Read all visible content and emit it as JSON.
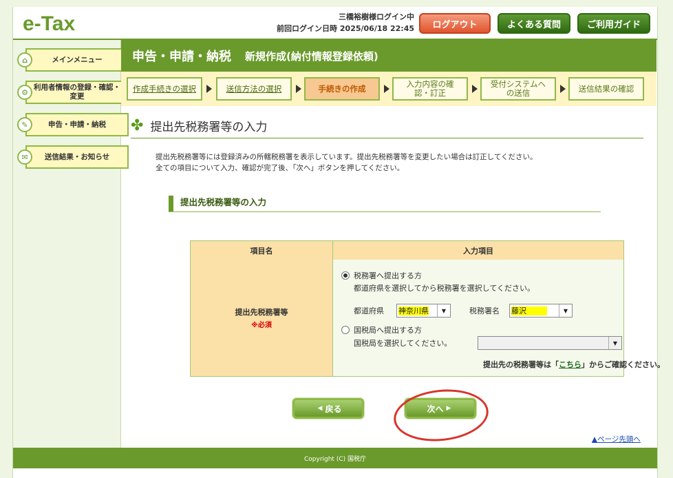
{
  "header": {
    "logo": "e-Tax",
    "user_status": "三橋裕樹様ログイン中",
    "last_login_label": "前回ログイン日時",
    "last_login_value": "2025/06/18 22:45",
    "logout_label": "ログアウト",
    "faq_label": "よくある質問",
    "guide_label": "ご利用ガイド"
  },
  "sidebar": {
    "items": [
      {
        "label": "メインメニュー",
        "icon": "home-icon"
      },
      {
        "label": "利用者情報の登録・確認・変更",
        "icon": "user-gear-icon"
      },
      {
        "label": "申告・申請・納税",
        "icon": "document-icon"
      },
      {
        "label": "送信結果・お知らせ",
        "icon": "mail-icon"
      }
    ]
  },
  "page": {
    "title": "申告・申請・納税",
    "subtitle": "新規作成(納付情報登録依頼)"
  },
  "steps": [
    {
      "label": "作成手続きの選択",
      "state": "link"
    },
    {
      "label": "送信方法の選択",
      "state": "link"
    },
    {
      "label": "手続きの作成",
      "state": "active"
    },
    {
      "label": "入力内容の確認・訂正",
      "state": "pending"
    },
    {
      "label": "受付システムへの送信",
      "state": "pending"
    },
    {
      "label": "送信結果の確認",
      "state": "pending"
    }
  ],
  "section": {
    "title": "提出先税務署等の入力",
    "desc1": "提出先税務署等には登録済みの所轄税務署を表示しています。提出先税務署等を変更したい場合は訂正してください。",
    "desc2": "全ての項目について入力、確認が完了後、「次へ」ボタンを押してください。",
    "sub_title": "提出先税務署等の入力"
  },
  "table": {
    "col1_header": "項目名",
    "col2_header": "入力項目",
    "row_label": "提出先税務署等",
    "required": "※必須",
    "radio1_label": "税務署へ提出する方",
    "radio1_hint": "都道府県を選択してから税務署を選択してください。",
    "pref_label": "都道府県",
    "pref_value": "神奈川県",
    "office_label": "税務署名",
    "office_value": "藤沢",
    "radio2_label": "国税局へ提出する方",
    "radio2_hint": "国税局を選択してください。",
    "bureau_value": "",
    "note_prefix": "提出先の税務署等は「",
    "note_link": "こちら",
    "note_suffix": "」からご確認ください。"
  },
  "buttons": {
    "back_label": "戻る",
    "next_label": "次へ"
  },
  "to_top": "ページ先頭へ",
  "footer": "Copyright (C) 国税庁"
}
